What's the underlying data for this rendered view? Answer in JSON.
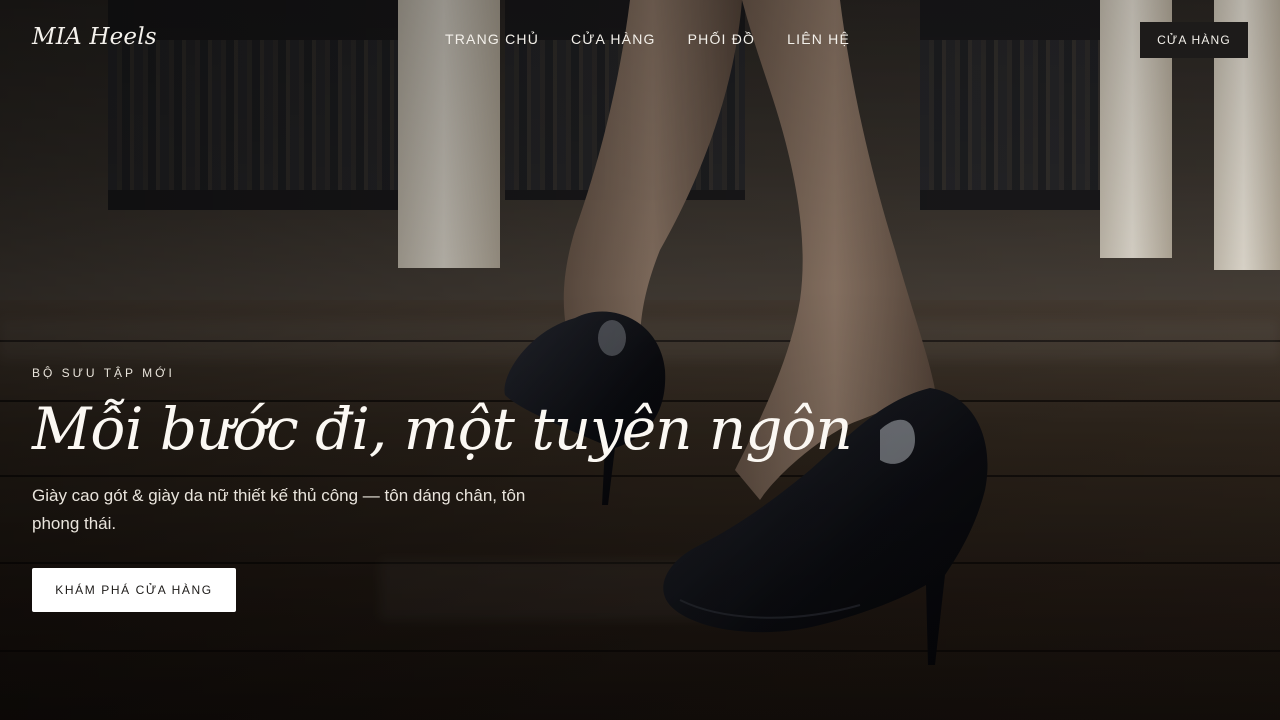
{
  "brand": {
    "logo": "MIA Heels"
  },
  "nav": {
    "items": [
      {
        "label": "TRANG CHỦ"
      },
      {
        "label": "CỬA HÀNG"
      },
      {
        "label": "PHỐI ĐỒ"
      },
      {
        "label": "LIÊN HỆ"
      }
    ],
    "shop_button": "CỬA HÀNG"
  },
  "hero": {
    "eyebrow": "BỘ SƯU TẬP MỚI",
    "title": "Mỗi bước đi, một tuyên ngôn",
    "subtitle": "Giày cao gót & giày da nữ thiết kế thủ công — tôn dáng chân, tôn phong thái.",
    "cta": "KHÁM PHÁ CỬA HÀNG",
    "background_image": "black-patent-pumps-walking-wooden-floor"
  },
  "colors": {
    "text": "#FFFFFF",
    "cta_background": "#FFFFFF",
    "cta_text": "#1C1A18",
    "header_button": "#1D1B1A"
  }
}
